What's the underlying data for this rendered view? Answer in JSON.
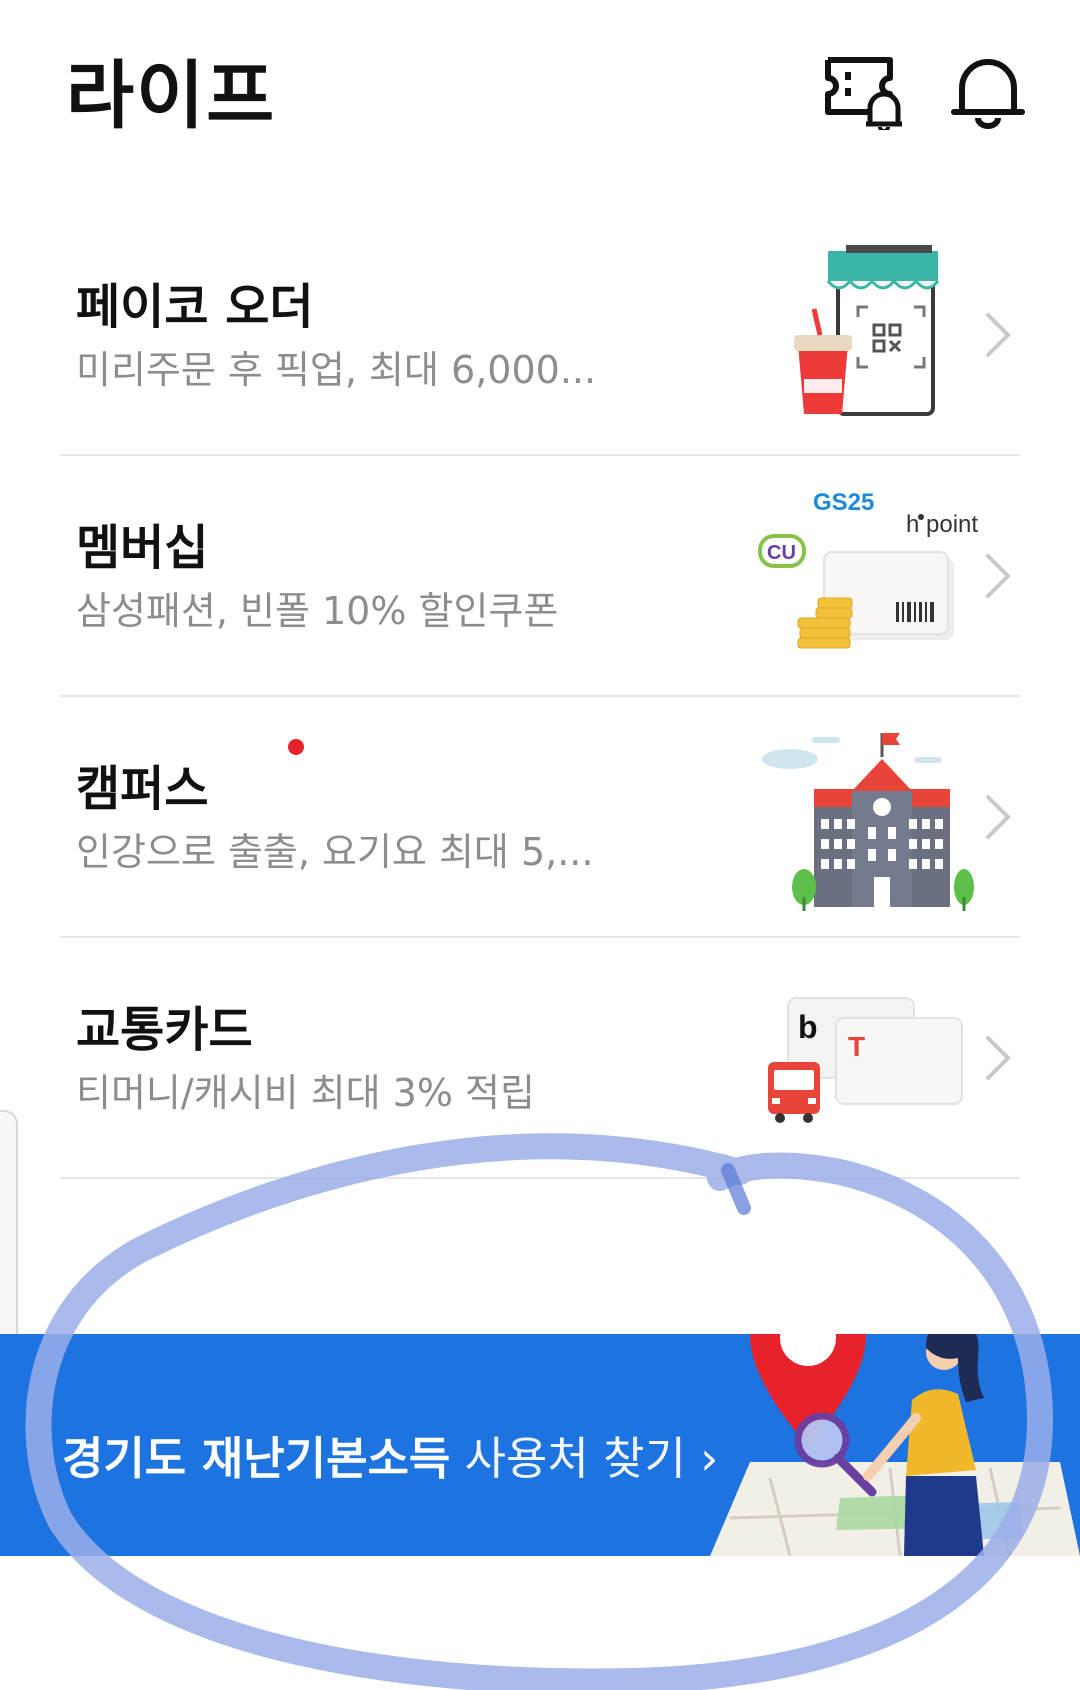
{
  "header": {
    "title": "라이프",
    "icons": [
      "ticket-bell-icon",
      "bell-icon"
    ]
  },
  "services": [
    {
      "title": "페이코 오더",
      "desc": "미리주문 후 픽업, 최대 6,000...",
      "illustration": "shop-qr-drink",
      "badge": false
    },
    {
      "title": "멤버십",
      "desc": "삼성패션, 빈폴 10% 할인쿠폰",
      "illustration": "membership-cards",
      "badge": false,
      "logos": {
        "gs25": "GS25",
        "cu": "CU",
        "hpoint": "point",
        "hpoint_h": "h"
      }
    },
    {
      "title": "캠퍼스",
      "desc": "인강으로 출출, 요기요 최대 5,...",
      "illustration": "campus-building",
      "badge": true
    },
    {
      "title": "교통카드",
      "desc": "티머니/캐시비 최대 3% 적립",
      "illustration": "bus-transit-cards",
      "badge": false,
      "logos": {
        "cashbee": "b",
        "tmoney": "T"
      }
    }
  ],
  "banner": {
    "bold_text": "경기도 재난기본소득",
    "light_text": "사용처 찾기",
    "chevron": "›",
    "background": "#1d73e0",
    "illustration": "map-pin-woman-magnifier"
  },
  "colors": {
    "accent_blue": "#1d73e0",
    "badge_red": "#e5222a",
    "text_gray": "#8d8d8d",
    "annotation": "#9aaee8"
  }
}
